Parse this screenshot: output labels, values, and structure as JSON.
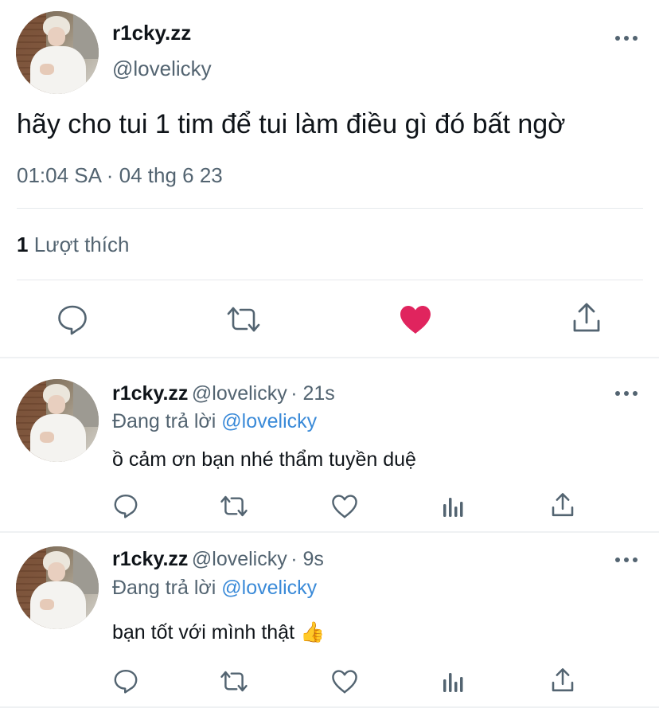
{
  "main_tweet": {
    "display_name": "r1cky.zz",
    "handle": "@lovelicky",
    "text": "hãy cho tui 1 tim để tui làm điều gì đó bất ngờ",
    "timestamp": "01:04 SA · 04 thg 6 23",
    "likes_count": "1",
    "likes_label": "Lượt thích",
    "liked": true,
    "like_color": "#e0245e"
  },
  "replies": [
    {
      "display_name": "r1cky.zz",
      "handle": "@lovelicky",
      "time": "· 21s",
      "replying_label": "Đang trả lời",
      "replying_to": "@lovelicky",
      "text": "ồ cảm ơn bạn nhé thẩm tuyền duệ"
    },
    {
      "display_name": "r1cky.zz",
      "handle": "@lovelicky",
      "time": "· 9s",
      "replying_label": "Đang trả lời",
      "replying_to": "@lovelicky",
      "text": "bạn tốt với mình thật",
      "emoji": "👍"
    }
  ],
  "colors": {
    "text": "#0f1419",
    "secondary": "#536471",
    "link": "#3a8ad8",
    "divider": "#e6e9ec"
  }
}
